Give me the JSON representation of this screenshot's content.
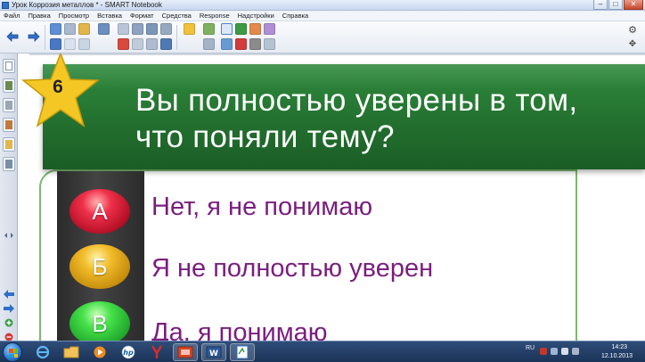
{
  "window": {
    "title": "Урок Коррозия металлов * - SMART Notebook",
    "buttons": [
      "–",
      "□",
      "✕"
    ]
  },
  "menu": {
    "items": [
      "Файл",
      "Правка",
      "Просмотр",
      "Вставка",
      "Формат",
      "Средства",
      "Response",
      "Надстройки",
      "Справка"
    ]
  },
  "slide": {
    "number": "6",
    "question": "Вы полностью уверены в том, что поняли тему?",
    "lights": [
      {
        "letter": "А",
        "answer": "Нет, я не понимаю",
        "color": "#e0283d"
      },
      {
        "letter": "Б",
        "answer": "Я не полностью уверен",
        "color": "#e5a81a"
      },
      {
        "letter": "В",
        "answer": "Да, я понимаю",
        "color": "#34c43a"
      }
    ],
    "colors": {
      "banner": "#226e2e",
      "answer_text": "#7a1e7e",
      "star": "#f4c724"
    }
  },
  "taskbar": {
    "language": "RU",
    "time": "14:23",
    "date": "12.10.2013"
  }
}
